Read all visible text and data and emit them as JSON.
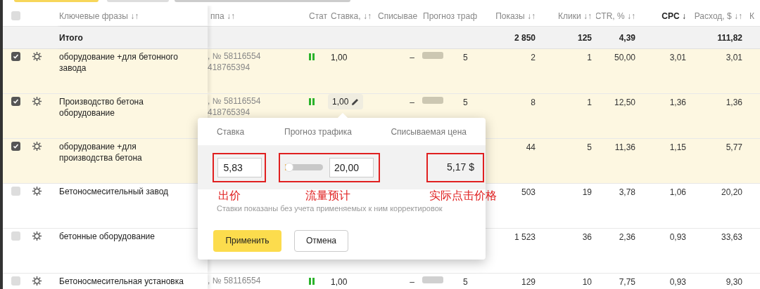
{
  "select_all": {
    "checked": false
  },
  "columns": [
    {
      "label": "Ключевые фразы",
      "sort": "↓↑",
      "selected": false
    },
    {
      "label": "ппа",
      "sort": "↓↑",
      "selected": false
    },
    {
      "label": "Стат",
      "selected": false
    },
    {
      "label": "Ставка,",
      "sort": "↓↑",
      "selected": false
    },
    {
      "label": "Списывае",
      "selected": false
    },
    {
      "label": "Прогноз траф",
      "selected": false
    },
    {
      "label": "Показы",
      "sort": "↓↑",
      "selected": false
    },
    {
      "label": "Клики",
      "sort": "↓↑",
      "selected": false
    },
    {
      "label": "CTR, %",
      "sort": "↓↑",
      "selected": false
    },
    {
      "label": "CPC",
      "sort": "↓",
      "selected": true
    },
    {
      "label": "Расход, $",
      "sort": "↓↑",
      "selected": false
    },
    {
      "label": "К",
      "selected": false
    }
  ],
  "total": {
    "label": "Итого",
    "impressions": "2 850",
    "clicks": "125",
    "ctr": "4,39",
    "cost": "111,82"
  },
  "rows": [
    {
      "checked": true,
      "phrase": "оборудование +для бетонного завода",
      "group": [
        ", № 58116554",
        "418765394"
      ],
      "paused": true,
      "bid": "1,00",
      "editing": false,
      "spend": "–",
      "forecast": "5",
      "impressions": "2",
      "clicks": "1",
      "ctr": "50,00",
      "cpc": "3,01",
      "cost": "3,01"
    },
    {
      "checked": true,
      "phrase": "Производство бетона оборудование",
      "group": [
        ", № 58116554",
        "418765394"
      ],
      "paused": true,
      "bid": "1,00",
      "editing": true,
      "spend": "–",
      "forecast": "5",
      "impressions": "8",
      "clicks": "1",
      "ctr": "12,50",
      "cpc": "1,36",
      "cost": "1,36"
    },
    {
      "checked": true,
      "phrase": "оборудование +для производства бетона",
      "impressions": "44",
      "clicks": "5",
      "ctr": "11,36",
      "cpc": "1,15",
      "cost": "5,77"
    },
    {
      "checked": false,
      "phrase": "Бетоносмесительный завод",
      "impressions": "503",
      "clicks": "19",
      "ctr": "3,78",
      "cpc": "1,06",
      "cost": "20,20"
    },
    {
      "checked": false,
      "phrase": "бетонные оборудование",
      "impressions": "1 523",
      "clicks": "36",
      "ctr": "2,36",
      "cpc": "0,93",
      "cost": "33,63"
    },
    {
      "checked": false,
      "phrase": "Бетоносмесительная установка",
      "group": [
        ", № 58116554"
      ],
      "paused": true,
      "bid": "1,00",
      "editing": false,
      "spend": "–",
      "forecast": "5",
      "impressions": "129",
      "clicks": "10",
      "ctr": "7,75",
      "cpc": "0,93",
      "cost": "9,30"
    }
  ],
  "popup": {
    "headers": [
      "Ставка",
      "Прогноз трафика",
      "Списываемая цена"
    ],
    "bid": "5,83",
    "traffic": {
      "level": 0.04,
      "value": "20,00"
    },
    "price": "5,17 $",
    "note": "Ставки показаны без учета применяемых к ним корректировок",
    "apply": "Применить",
    "cancel": "Отмена",
    "annotations": [
      "出价",
      "流量预计",
      "实际点击价格"
    ]
  }
}
